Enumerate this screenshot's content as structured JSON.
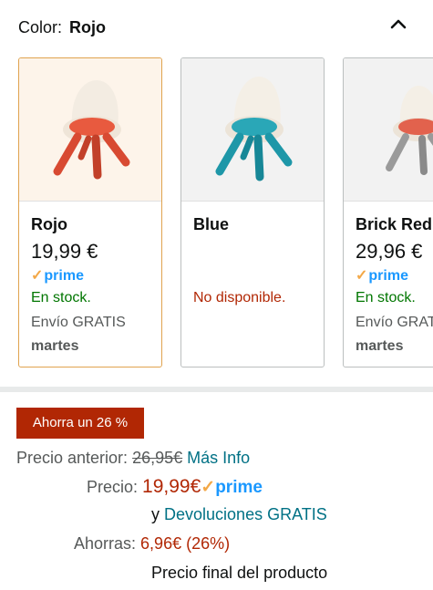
{
  "color_selector": {
    "label": "Color:",
    "selected": "Rojo",
    "collapse_icon": "chevron-up-icon"
  },
  "variants": [
    {
      "name": "Rojo",
      "price": "19,99 €",
      "prime": "prime",
      "availability": "En stock.",
      "shipping": "Envío GRATIS",
      "delivery_day": "martes",
      "selected": true,
      "seat_color": "#e85a3f",
      "legs_color": "#d84a32"
    },
    {
      "name": "Blue",
      "price": "",
      "prime": "",
      "availability": "No disponible.",
      "shipping": "",
      "delivery_day": "",
      "selected": false,
      "seat_color": "#2aa7b7",
      "legs_color": "#1e97a8"
    },
    {
      "name": "Brick Red",
      "price": "29,96 €",
      "prime": "prime",
      "availability": "En stock.",
      "shipping": "Envío GRATIS",
      "delivery_day": "martes",
      "selected": false,
      "seat_color": "#e2624d",
      "legs_color": "#9a9a9a"
    }
  ],
  "pricing": {
    "badge": "Ahorra un 26 %",
    "previous_label": "Precio anterior:",
    "previous_price": "26,95€",
    "more_info": "Más Info",
    "price_label": "Precio:",
    "price": "19,99€",
    "prime": "prime",
    "returns_prefix": "y",
    "returns_link": "Devoluciones GRATIS",
    "savings_label": "Ahorras:",
    "savings": "6,96€ (26%)",
    "final_note": "Precio final del producto"
  },
  "colors": {
    "accent_red": "#b12704",
    "stock_green": "#007600",
    "link_teal": "#007185",
    "prime_blue": "#1a98ff",
    "prime_check": "#f3a847",
    "selected_border": "#e0a34f"
  }
}
